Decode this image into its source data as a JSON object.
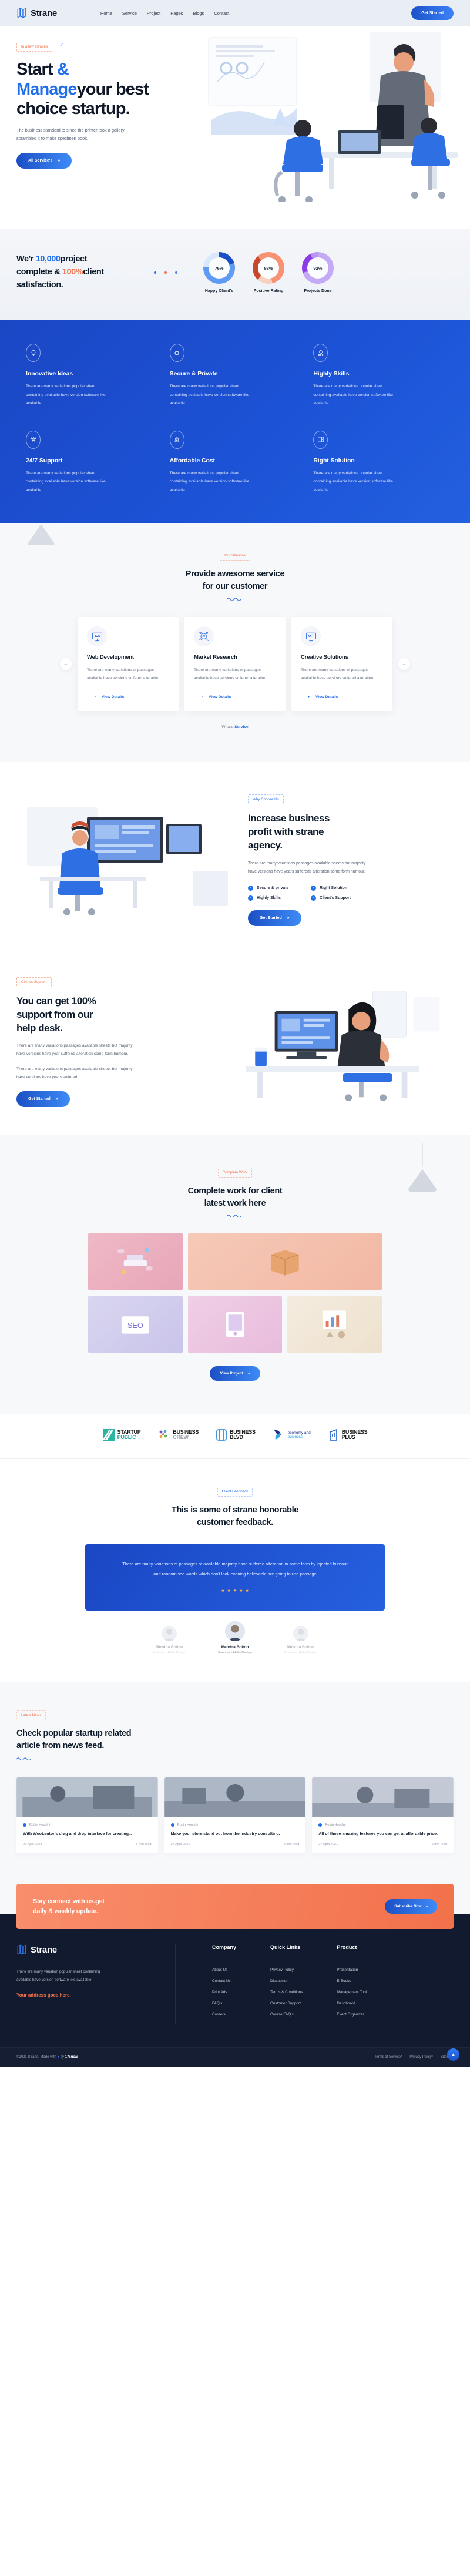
{
  "header": {
    "brand": "Strane",
    "nav": [
      "Home",
      "Service",
      "Project",
      "Pages",
      "Blogs",
      "Contact"
    ],
    "cta": "Get Started"
  },
  "hero": {
    "badge": "In a few minutes",
    "title_1": "Start ",
    "title_accent_1": "&",
    "title_accent_2": "Manage",
    "title_2": "your best",
    "title_3": "choice startup.",
    "paragraph": "The business standard to since the printer took a gallery scrambled it to make specimen book.",
    "cta": "All Service's"
  },
  "stats": {
    "heading_1": "We'r ",
    "heading_num": "10,000",
    "heading_2": "project",
    "heading_3": "complete & ",
    "heading_pct": "100%",
    "heading_4": "client",
    "heading_5": "satisfaction.",
    "rings": [
      {
        "value": "76%",
        "label": "Happy Client's",
        "color": "#2f6fe4"
      },
      {
        "value": "88%",
        "label": "Positive Rating",
        "color": "#f2714b"
      },
      {
        "value": "92%",
        "label": "Projects Done",
        "color": "#8b5cf6"
      }
    ]
  },
  "features": [
    {
      "title": "Innovative Ideas",
      "icon": "lightbulb-icon",
      "text": "There are many variations popular sheet containing available have version software like available."
    },
    {
      "title": "Secure & Private",
      "icon": "shield-chip-icon",
      "text": "There are many variations popular sheet containing available have version software like available."
    },
    {
      "title": "Highly Skills",
      "icon": "skills-icon",
      "text": "There are many variations popular sheet containing available have version software like available."
    },
    {
      "title": "24/7 Support",
      "icon": "support-icon",
      "text": "There are many variations popular sheet containing available have version software like available."
    },
    {
      "title": "Affordable Cost",
      "icon": "cost-icon",
      "text": "There are many variations popular sheet containing available have version software like available."
    },
    {
      "title": "Right Solution",
      "icon": "solution-icon",
      "text": "There are many variations popular sheet containing available have version software like available."
    }
  ],
  "services": {
    "badge": "Our Services",
    "title_1": "Provide awesome service",
    "title_2": "for our customer",
    "cards": [
      {
        "title": "Web Development",
        "icon": "monitor-code-icon",
        "text": "There are many variations of passages available have versions suffered alteration.",
        "link": "View Details"
      },
      {
        "title": "Market Research",
        "icon": "magnifier-chart-icon",
        "text": "There are many variations of passages available have versions suffered alteration.",
        "link": "View Details"
      },
      {
        "title": "Creative Solutions",
        "icon": "monitor-idea-icon",
        "text": "There are many variations of passages available have versions suffered alteration.",
        "link": "View Details"
      }
    ],
    "all_prefix": "What's ",
    "all_link": "Service"
  },
  "why": {
    "badge": "Why Choose Us",
    "title_1": "Increase business",
    "title_2": "profit with strane",
    "title_3": "agency.",
    "paragraph": "There are many variations passages available sheets but majority have versions have years suffereds alteration some form humour.",
    "checks": [
      "Secure & private",
      "Right Solution",
      "Highly Skills",
      "Client's Support"
    ],
    "cta": "Get Started"
  },
  "support": {
    "badge": "Client's Support",
    "title_1": "You can get 100%",
    "title_2": "support from our",
    "title_3": "help desk.",
    "paragraph_1": "There are many variations passages available sheets but majority have versions have year suffered alteration some form humour.",
    "paragraph_2": "There are many variations passages available sheets but majority have versions have years suffered.",
    "cta": "Get Started"
  },
  "portfolio": {
    "badge": "Complete Work",
    "title_1": "Complete work for client",
    "title_2": "latest work here",
    "cta": "View Project",
    "items": [
      {
        "name": "work-pills-pink",
        "c1": "#efb9c6",
        "c2": "#e8a6b8"
      },
      {
        "name": "work-box-peach",
        "c1": "#f6c9b8",
        "c2": "#f2b8a3"
      },
      {
        "name": "work-seo-lavender",
        "c1": "#d9d6f0",
        "c2": "#c9c4ea"
      },
      {
        "name": "work-game-pink",
        "c1": "#f0cfe6",
        "c2": "#e8bcdc"
      },
      {
        "name": "work-chart-cream",
        "c1": "#f4ece0",
        "c2": "#eee1cd"
      }
    ]
  },
  "brands": [
    {
      "line1": "STARTUP",
      "line2": "PUBLIC",
      "c1": "#1a1a1a",
      "c2": "#21a3a3",
      "mark": "#2bb3a3"
    },
    {
      "line1": "BUSINESS",
      "line2": "CREW",
      "c1": "#1a1a1a",
      "c2": "#9aa1ad",
      "mark": "#6bbf59"
    },
    {
      "line1": "BUSINESS",
      "line2": "BLVD",
      "c1": "#1a1a1a",
      "c2": "#1a1a1a",
      "mark": "#1b7fd6"
    },
    {
      "line1": "economy and",
      "line2": "business",
      "c1": "#1b2b8c",
      "c2": "#2fa8e0",
      "mark": "#1b2b8c"
    },
    {
      "line1": "BUSINESS",
      "line2": "PLUS",
      "c1": "#1a1a1a",
      "c2": "#1a1a1a",
      "mark": "#1b5fc9"
    }
  ],
  "testimonials": {
    "badge": "Client Feedback",
    "title_1": "This is some of strane honorable",
    "title_2": "customer feedback.",
    "quote": "There are many variations of passages of available majority have suffered alteration in some form by injected humour and randomised words which don't look evening believable are going to use passage",
    "stars": 5,
    "people": [
      {
        "name": "Melvina Bolton",
        "role": "Founder - Hello Design",
        "dim": true
      },
      {
        "name": "Melvina Bolton",
        "role": "Founder - Hello Design",
        "dim": false
      },
      {
        "name": "Melvina Bolton",
        "role": "Founder - Hello Design",
        "dim": true
      }
    ]
  },
  "blog": {
    "badge": "Latest News",
    "title_1": "Check popular startup related",
    "title_2": "article from news feed.",
    "posts": [
      {
        "author": "Robin Hoodini",
        "title": "With WooLentor's drag and drop interface for creating...",
        "date": "27 April 2021",
        "read": "5 min read"
      },
      {
        "author": "Robin Hoodini",
        "title": "Make your store stand out from the industry consulting.",
        "date": "27 April 2021",
        "read": "5 min read"
      },
      {
        "author": "Robin Hoodini",
        "title": "All of those amazing features you can get at affordable price.",
        "date": "27 April 2021",
        "read": "5 min read"
      }
    ]
  },
  "newsletter": {
    "title_1": "Stay connect with us.get",
    "title_2": "daily & weekly update.",
    "cta": "Subscribe Now"
  },
  "footer": {
    "brand": "Strane",
    "about": "There are many variation popular sheet containing available have version software like available.",
    "address": "Your address goes here.",
    "columns": [
      {
        "title": "Company",
        "links": [
          "About Us",
          "Contact Us",
          "Print Ads",
          "FAQ's",
          "Careers"
        ]
      },
      {
        "title": "Quick Links",
        "links": [
          "Privacy Policy",
          "Discussion",
          "Terms & Conditions",
          "Customer Support",
          "Course FAQ's"
        ]
      },
      {
        "title": "Product",
        "links": [
          "Presentation",
          "E-Books",
          "Management Tool",
          "Dashboard",
          "Event Organizer"
        ]
      }
    ],
    "copyright_1": "©2021 Strane. Made with ",
    "copyright_2": " by ",
    "copyright_brand": "17sucai",
    "bottom_links": [
      "Terms of Service*",
      "Privacy Policy*",
      "Sitemap"
    ]
  }
}
